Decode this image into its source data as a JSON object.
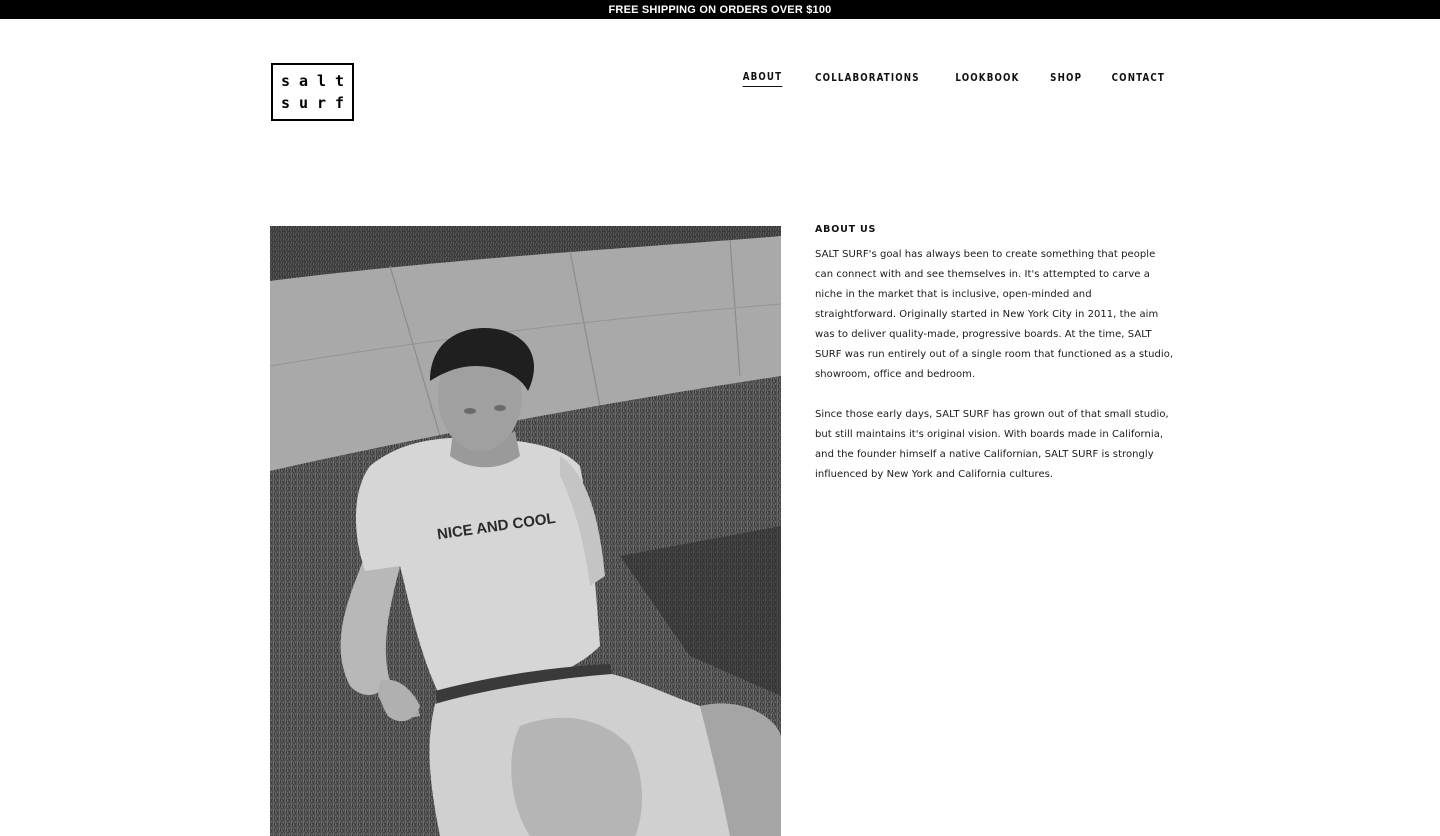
{
  "announcement": {
    "text": "FREE SHIPPING ON ORDERS OVER $100"
  },
  "logo": {
    "line1": "salt",
    "line2": "surf"
  },
  "nav": {
    "items": [
      {
        "label": "ABOUT",
        "active": true
      },
      {
        "label": "COLLABORATIONS",
        "active": false
      },
      {
        "label": "LOOKBOOK",
        "active": false
      },
      {
        "label": "SHOP",
        "active": false
      },
      {
        "label": "CONTACT",
        "active": false
      }
    ]
  },
  "hero_image": {
    "shirt_text": "NICE AND COOL"
  },
  "about": {
    "heading": "ABOUT US",
    "paragraphs": [
      "SALT SURF's goal has always been to create something that people can connect with and see themselves in. It's attempted to carve a niche in the market that is inclusive, open-minded and straightforward. Originally started in New York City in 2011, the aim was to deliver quality-made, progressive boards. At the time, SALT SURF was run entirely out of a single room that functioned as a studio, showroom, office and bedroom.",
      "Since those early days, SALT SURF has grown out of that small studio, but still maintains it's original vision. With boards made in California, and the founder himself a native Californian, SALT SURF is strongly influenced by New York and California cultures."
    ]
  }
}
